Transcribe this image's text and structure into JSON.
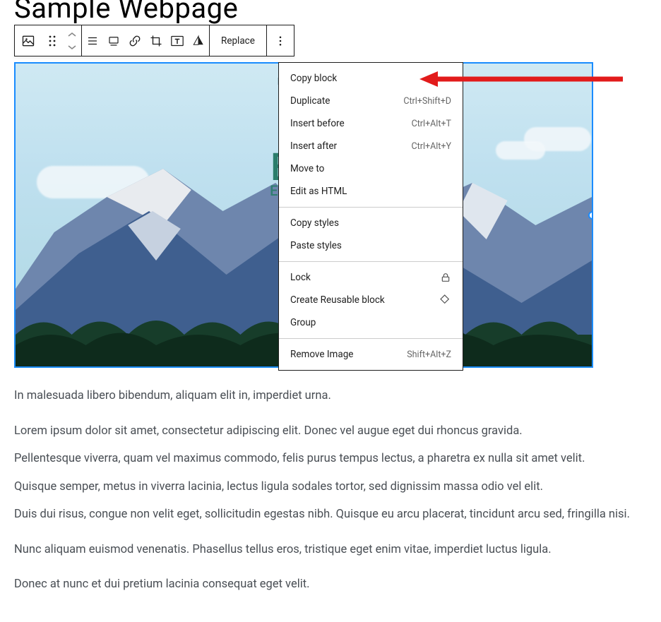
{
  "page": {
    "title": "Sample Webpage"
  },
  "toolbar": {
    "replace_label": "Replace"
  },
  "image_overlay": {
    "label": "EARTH",
    "heading": "EA",
    "subheading": "ENDLE"
  },
  "menu": {
    "s1": [
      {
        "label": "Copy block",
        "shortcut": ""
      },
      {
        "label": "Duplicate",
        "shortcut": "Ctrl+Shift+D"
      },
      {
        "label": "Insert before",
        "shortcut": "Ctrl+Alt+T"
      },
      {
        "label": "Insert after",
        "shortcut": "Ctrl+Alt+Y"
      },
      {
        "label": "Move to",
        "shortcut": ""
      },
      {
        "label": "Edit as HTML",
        "shortcut": ""
      }
    ],
    "s2": [
      {
        "label": "Copy styles",
        "shortcut": ""
      },
      {
        "label": "Paste styles",
        "shortcut": ""
      }
    ],
    "s3": [
      {
        "label": "Lock",
        "icon": "lock"
      },
      {
        "label": "Create Reusable block",
        "icon": "reusable"
      },
      {
        "label": "Group",
        "icon": ""
      }
    ],
    "s4": [
      {
        "label": "Remove Image",
        "shortcut": "Shift+Alt+Z"
      }
    ]
  },
  "paragraphs": {
    "p1": "In malesuada libero bibendum, aliquam elit in, imperdiet urna.",
    "p2": "Lorem ipsum dolor sit amet, consectetur adipiscing elit. Donec vel augue eget dui rhoncus gravida.",
    "p3": "Pellentesque viverra, quam vel maximus commodo, felis purus tempus lectus, a pharetra ex nulla sit amet velit.",
    "p4": "Quisque semper, metus in viverra lacinia, lectus ligula sodales tortor, sed dignissim massa odio vel elit.",
    "p5": "Duis dui risus, congue non velit eget, sollicitudin egestas nibh. Quisque eu arcu placerat, tincidunt arcu sed, fringilla nisi.",
    "p6": "Nunc aliquam euismod venenatis. Phasellus tellus eros, tristique eget enim vitae, imperdiet luctus ligula.",
    "p7": "Donec at nunc et dui pretium lacinia consequat eget velit."
  }
}
